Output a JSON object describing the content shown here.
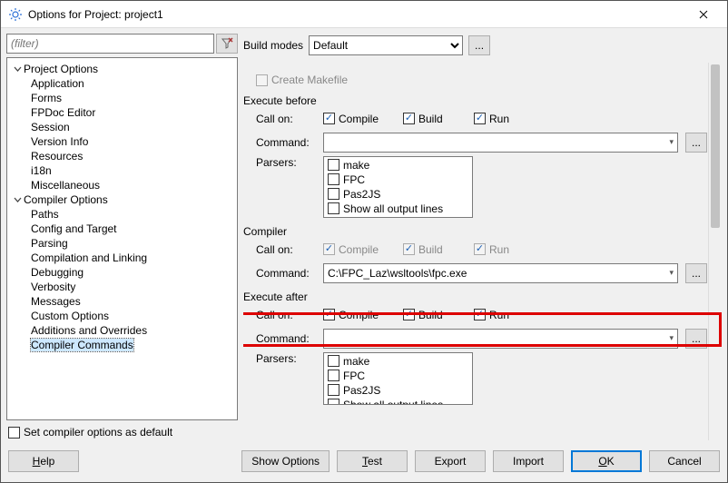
{
  "window": {
    "title": "Options for Project: project1"
  },
  "filter": {
    "placeholder": "(filter)"
  },
  "tree": {
    "group1": {
      "title": "Project Options",
      "items": [
        "Application",
        "Forms",
        "FPDoc Editor",
        "Session",
        "Version Info",
        "Resources",
        "i18n",
        "Miscellaneous"
      ]
    },
    "group2": {
      "title": "Compiler Options",
      "items": [
        "Paths",
        "Config and Target",
        "Parsing",
        "Compilation and Linking",
        "Debugging",
        "Verbosity",
        "Messages",
        "Custom Options",
        "Additions and Overrides",
        "Compiler Commands"
      ]
    }
  },
  "set_default_label": "Set compiler options as default",
  "build_modes": {
    "label": "Build modes",
    "selected": "Default",
    "more": "..."
  },
  "create_makefile": "Create Makefile",
  "exec_before": {
    "title": "Execute before",
    "callon": "Call on:",
    "compile": "Compile",
    "build": "Build",
    "run": "Run",
    "command_label": "Command:",
    "command_value": "",
    "parsers_label": "Parsers:",
    "parsers": [
      "make",
      "FPC",
      "Pas2JS",
      "Show all output lines"
    ]
  },
  "compiler": {
    "title": "Compiler",
    "callon": "Call on:",
    "compile": "Compile",
    "build": "Build",
    "run": "Run",
    "command_label": "Command:",
    "command_value": "C:\\FPC_Laz\\wsltools\\fpc.exe"
  },
  "exec_after": {
    "title": "Execute after",
    "callon": "Call on:",
    "compile": "Compile",
    "build": "Build",
    "run": "Run",
    "command_label": "Command:",
    "command_value": "",
    "parsers_label": "Parsers:",
    "parsers": [
      "make",
      "FPC",
      "Pas2JS",
      "Show all output lines"
    ]
  },
  "buttons": {
    "help": "Help",
    "show_options": "Show Options",
    "test": "Test",
    "export": "Export",
    "import": "Import",
    "ok": "OK",
    "cancel": "Cancel"
  }
}
